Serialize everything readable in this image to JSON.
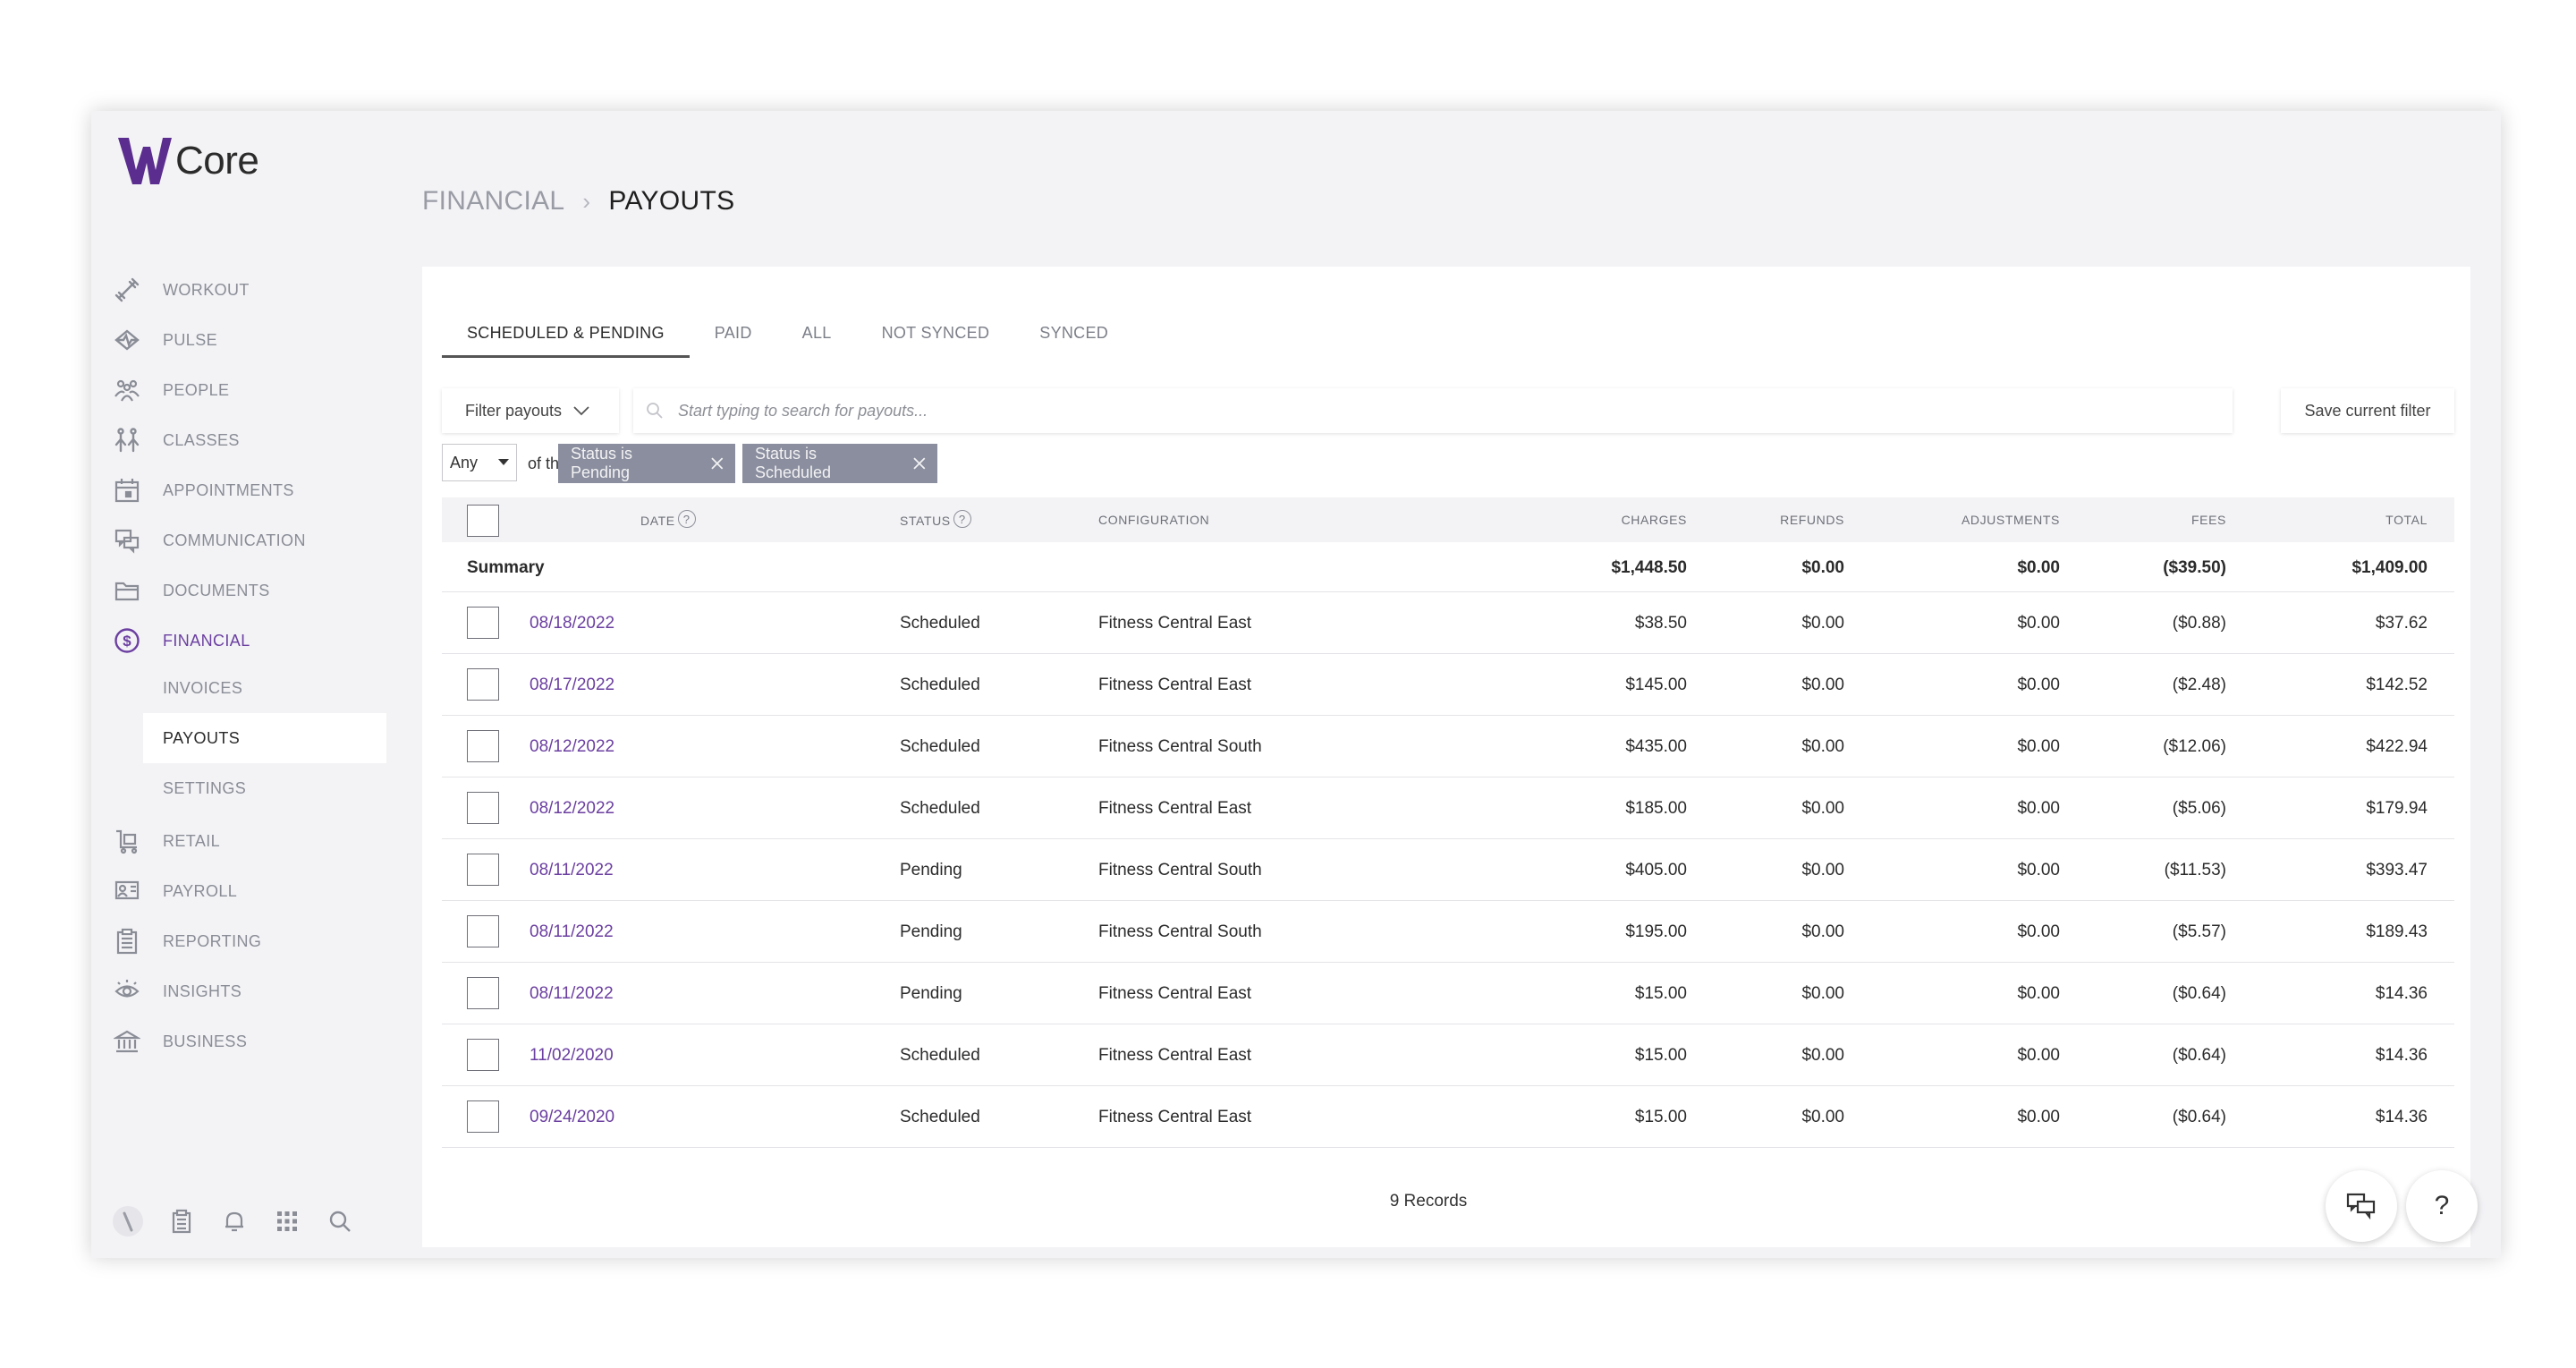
{
  "app": {
    "name": "Core",
    "accent": "#6b3fa0",
    "logo_color": "#5b2d8e"
  },
  "sidebar": {
    "items": [
      {
        "label": "WORKOUT",
        "icon": "dumbbell-icon"
      },
      {
        "label": "PULSE",
        "icon": "pulse-icon"
      },
      {
        "label": "PEOPLE",
        "icon": "people-icon"
      },
      {
        "label": "CLASSES",
        "icon": "classes-icon"
      },
      {
        "label": "APPOINTMENTS",
        "icon": "calendar-icon"
      },
      {
        "label": "COMMUNICATION",
        "icon": "chat-icon"
      },
      {
        "label": "DOCUMENTS",
        "icon": "folder-icon"
      },
      {
        "label": "FINANCIAL",
        "icon": "dollar-icon"
      },
      {
        "label": "RETAIL",
        "icon": "retail-icon"
      },
      {
        "label": "PAYROLL",
        "icon": "payroll-icon"
      },
      {
        "label": "REPORTING",
        "icon": "clipboard-icon"
      },
      {
        "label": "INSIGHTS",
        "icon": "eye-icon"
      },
      {
        "label": "BUSINESS",
        "icon": "bank-icon"
      }
    ],
    "sub_items": [
      {
        "label": "INVOICES"
      },
      {
        "label": "PAYOUTS"
      },
      {
        "label": "SETTINGS"
      }
    ],
    "active_item": "FINANCIAL",
    "selected_sub_item": "PAYOUTS",
    "bottom_icons": [
      "avatar",
      "clipboard-icon",
      "bell-icon",
      "apps-grid-icon",
      "search-icon"
    ]
  },
  "breadcrumb": {
    "parent": "FINANCIAL",
    "separator": "›",
    "current": "PAYOUTS"
  },
  "tabs": [
    {
      "label": "SCHEDULED & PENDING",
      "active": true
    },
    {
      "label": "PAID",
      "active": false
    },
    {
      "label": "ALL",
      "active": false
    },
    {
      "label": "NOT SYNCED",
      "active": false
    },
    {
      "label": "SYNCED",
      "active": false
    }
  ],
  "filters": {
    "filter_button": "Filter payouts",
    "search_placeholder": "Start typing to search for payouts...",
    "save_button": "Save current filter",
    "match_select": "Any",
    "match_suffix": "of the following:",
    "chips": [
      "Status is Pending",
      "Status is Scheduled"
    ]
  },
  "table": {
    "columns": {
      "date": "DATE",
      "status": "STATUS",
      "configuration": "CONFIGURATION",
      "charges": "CHARGES",
      "refunds": "REFUNDS",
      "adjustments": "ADJUSTMENTS",
      "fees": "FEES",
      "total": "TOTAL"
    },
    "help_glyph": "?",
    "summary": {
      "label": "Summary",
      "charges": "$1,448.50",
      "refunds": "$0.00",
      "adjustments": "$0.00",
      "fees": "($39.50)",
      "total": "$1,409.00"
    },
    "rows": [
      {
        "date": "08/18/2022",
        "status": "Scheduled",
        "configuration": "Fitness Central East",
        "charges": "$38.50",
        "refunds": "$0.00",
        "adjustments": "$0.00",
        "fees": "($0.88)",
        "total": "$37.62"
      },
      {
        "date": "08/17/2022",
        "status": "Scheduled",
        "configuration": "Fitness Central East",
        "charges": "$145.00",
        "refunds": "$0.00",
        "adjustments": "$0.00",
        "fees": "($2.48)",
        "total": "$142.52"
      },
      {
        "date": "08/12/2022",
        "status": "Scheduled",
        "configuration": "Fitness Central South",
        "charges": "$435.00",
        "refunds": "$0.00",
        "adjustments": "$0.00",
        "fees": "($12.06)",
        "total": "$422.94"
      },
      {
        "date": "08/12/2022",
        "status": "Scheduled",
        "configuration": "Fitness Central East",
        "charges": "$185.00",
        "refunds": "$0.00",
        "adjustments": "$0.00",
        "fees": "($5.06)",
        "total": "$179.94"
      },
      {
        "date": "08/11/2022",
        "status": "Pending",
        "configuration": "Fitness Central South",
        "charges": "$405.00",
        "refunds": "$0.00",
        "adjustments": "$0.00",
        "fees": "($11.53)",
        "total": "$393.47"
      },
      {
        "date": "08/11/2022",
        "status": "Pending",
        "configuration": "Fitness Central South",
        "charges": "$195.00",
        "refunds": "$0.00",
        "adjustments": "$0.00",
        "fees": "($5.57)",
        "total": "$189.43"
      },
      {
        "date": "08/11/2022",
        "status": "Pending",
        "configuration": "Fitness Central East",
        "charges": "$15.00",
        "refunds": "$0.00",
        "adjustments": "$0.00",
        "fees": "($0.64)",
        "total": "$14.36"
      },
      {
        "date": "11/02/2020",
        "status": "Scheduled",
        "configuration": "Fitness Central East",
        "charges": "$15.00",
        "refunds": "$0.00",
        "adjustments": "$0.00",
        "fees": "($0.64)",
        "total": "$14.36"
      },
      {
        "date": "09/24/2020",
        "status": "Scheduled",
        "configuration": "Fitness Central East",
        "charges": "$15.00",
        "refunds": "$0.00",
        "adjustments": "$0.00",
        "fees": "($0.64)",
        "total": "$14.36"
      }
    ],
    "record_count": "9 Records"
  },
  "fabs": [
    {
      "icon": "chat-icon"
    },
    {
      "label": "?",
      "icon": "help-icon"
    }
  ]
}
